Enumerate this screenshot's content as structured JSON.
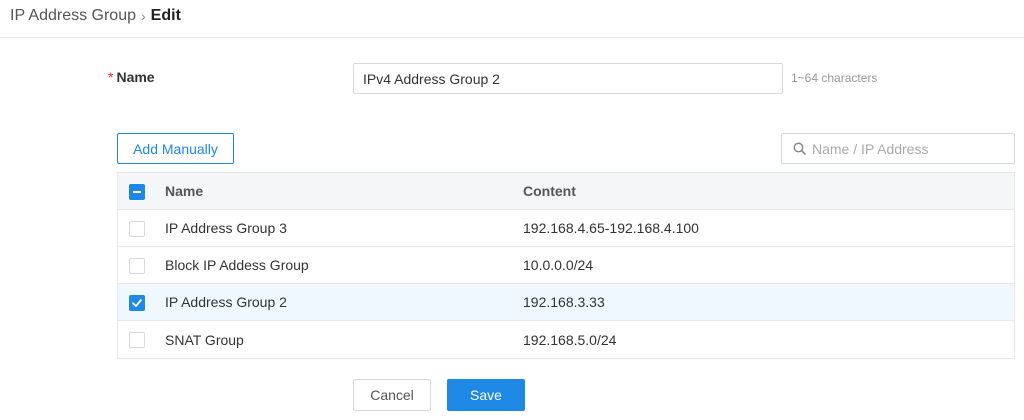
{
  "breadcrumb": {
    "parent": "IP Address Group",
    "separator": "›",
    "current": "Edit"
  },
  "form": {
    "name_required_mark": "*",
    "name_label": "Name",
    "name_value": "IPv4 Address Group 2",
    "name_hint": "1~64 characters"
  },
  "toolbar": {
    "add_manually_label": "Add Manually",
    "search_placeholder": "Name / IP Address",
    "search_icon": "search-icon"
  },
  "table": {
    "header_checkbox_state": "indeterminate",
    "columns": {
      "name": "Name",
      "content": "Content"
    },
    "rows": [
      {
        "name": "IP Address Group 3",
        "content": "192.168.4.65-192.168.4.100",
        "checked": false
      },
      {
        "name": "Block IP Addess Group",
        "content": "10.0.0.0/24",
        "checked": false
      },
      {
        "name": "IP Address Group 2",
        "content": "192.168.3.33",
        "checked": true
      },
      {
        "name": "SNAT Group",
        "content": "192.168.5.0/24",
        "checked": false
      }
    ]
  },
  "actions": {
    "cancel_label": "Cancel",
    "save_label": "Save"
  },
  "colors": {
    "accent": "#1e88e5",
    "required": "#f5222d",
    "selected_row": "#f0f8ff",
    "header_row": "#f5f6f7"
  }
}
